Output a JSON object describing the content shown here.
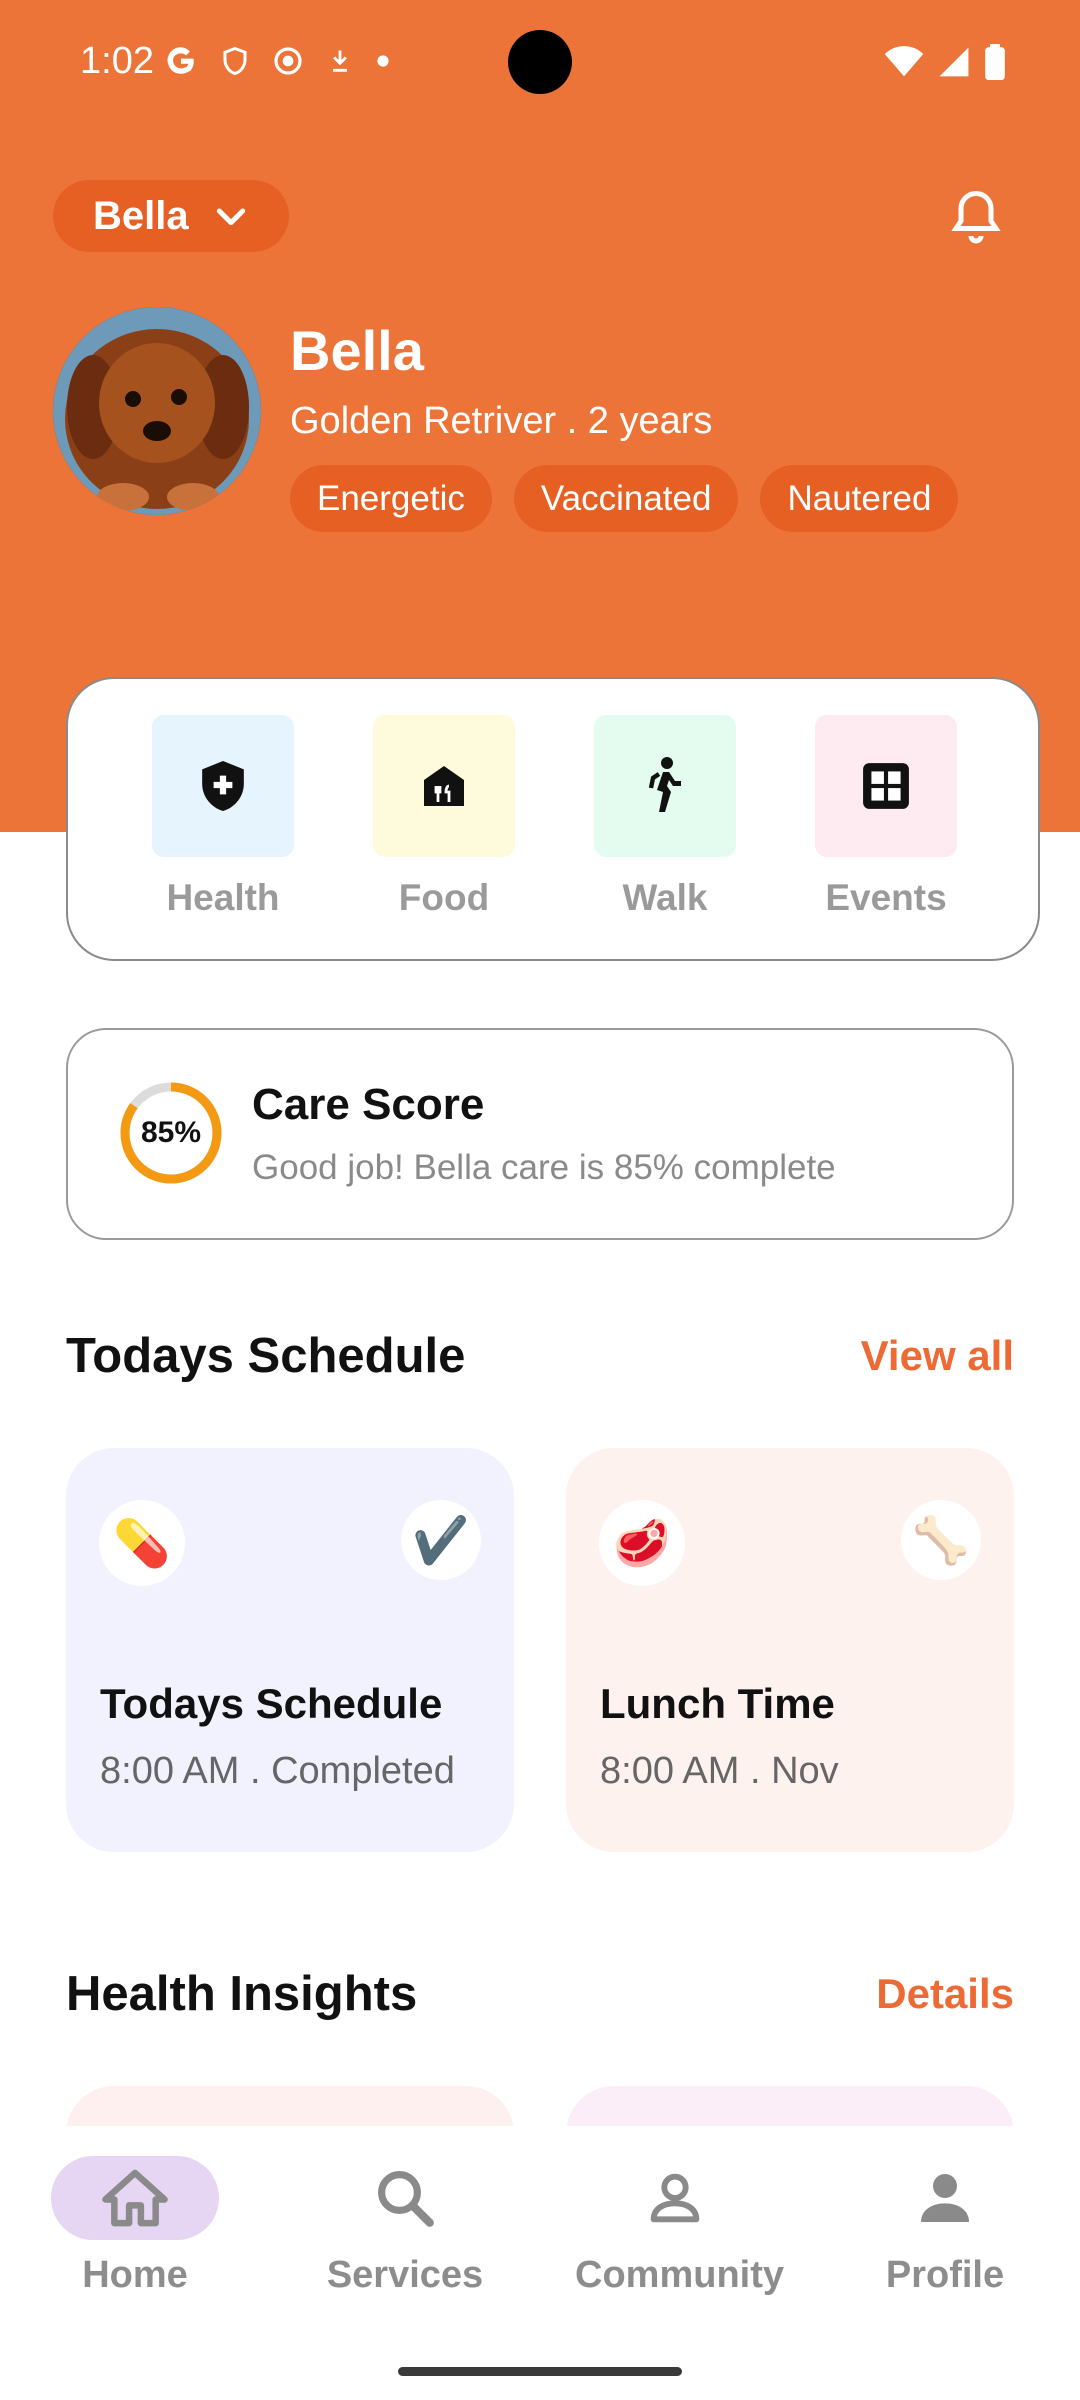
{
  "status_bar": {
    "time": "1:02"
  },
  "header": {
    "pet_selector": "Bella"
  },
  "profile": {
    "name": "Bella",
    "breed_age": "Golden Retriver . 2 years",
    "tags": [
      "Energetic",
      "Vaccinated",
      "Nautered"
    ]
  },
  "quick_actions": [
    {
      "label": "Health",
      "icon": "shield-plus-icon",
      "color": "#E6F4FD"
    },
    {
      "label": "Food",
      "icon": "food-icon",
      "color": "#FEFBDD"
    },
    {
      "label": "Walk",
      "icon": "walk-icon",
      "color": "#E4FCEF"
    },
    {
      "label": "Events",
      "icon": "grid-icon",
      "color": "#FDEBF1"
    }
  ],
  "care_score": {
    "percent_label": "85%",
    "value": 0.85,
    "title": "Care Score",
    "subtitle": "Good job! Bella care is 85% complete"
  },
  "schedule": {
    "title": "Todays Schedule",
    "link": "View all",
    "cards": [
      {
        "title": "Todays Schedule",
        "subtitle": "8:00 AM . Completed",
        "icon_left": "💊",
        "icon_right": "✔️",
        "bg": "#F1F2FE"
      },
      {
        "title": "Lunch Time",
        "subtitle": "8:00 AM . Nov",
        "icon_left": "🥩",
        "icon_right": "🦴",
        "bg": "#FDF2EE"
      }
    ]
  },
  "insights": {
    "title": "Health Insights",
    "link": "Details"
  },
  "nav": [
    {
      "label": "Home",
      "icon": "home-icon",
      "active": true
    },
    {
      "label": "Services",
      "icon": "search-icon",
      "active": false
    },
    {
      "label": "Community",
      "icon": "community-icon",
      "active": false
    },
    {
      "label": "Profile",
      "icon": "person-icon",
      "active": false
    }
  ],
  "colors": {
    "brand": "#ED7438",
    "accent_text": "#EE6A35",
    "nav_active": "#E6D6F4"
  }
}
